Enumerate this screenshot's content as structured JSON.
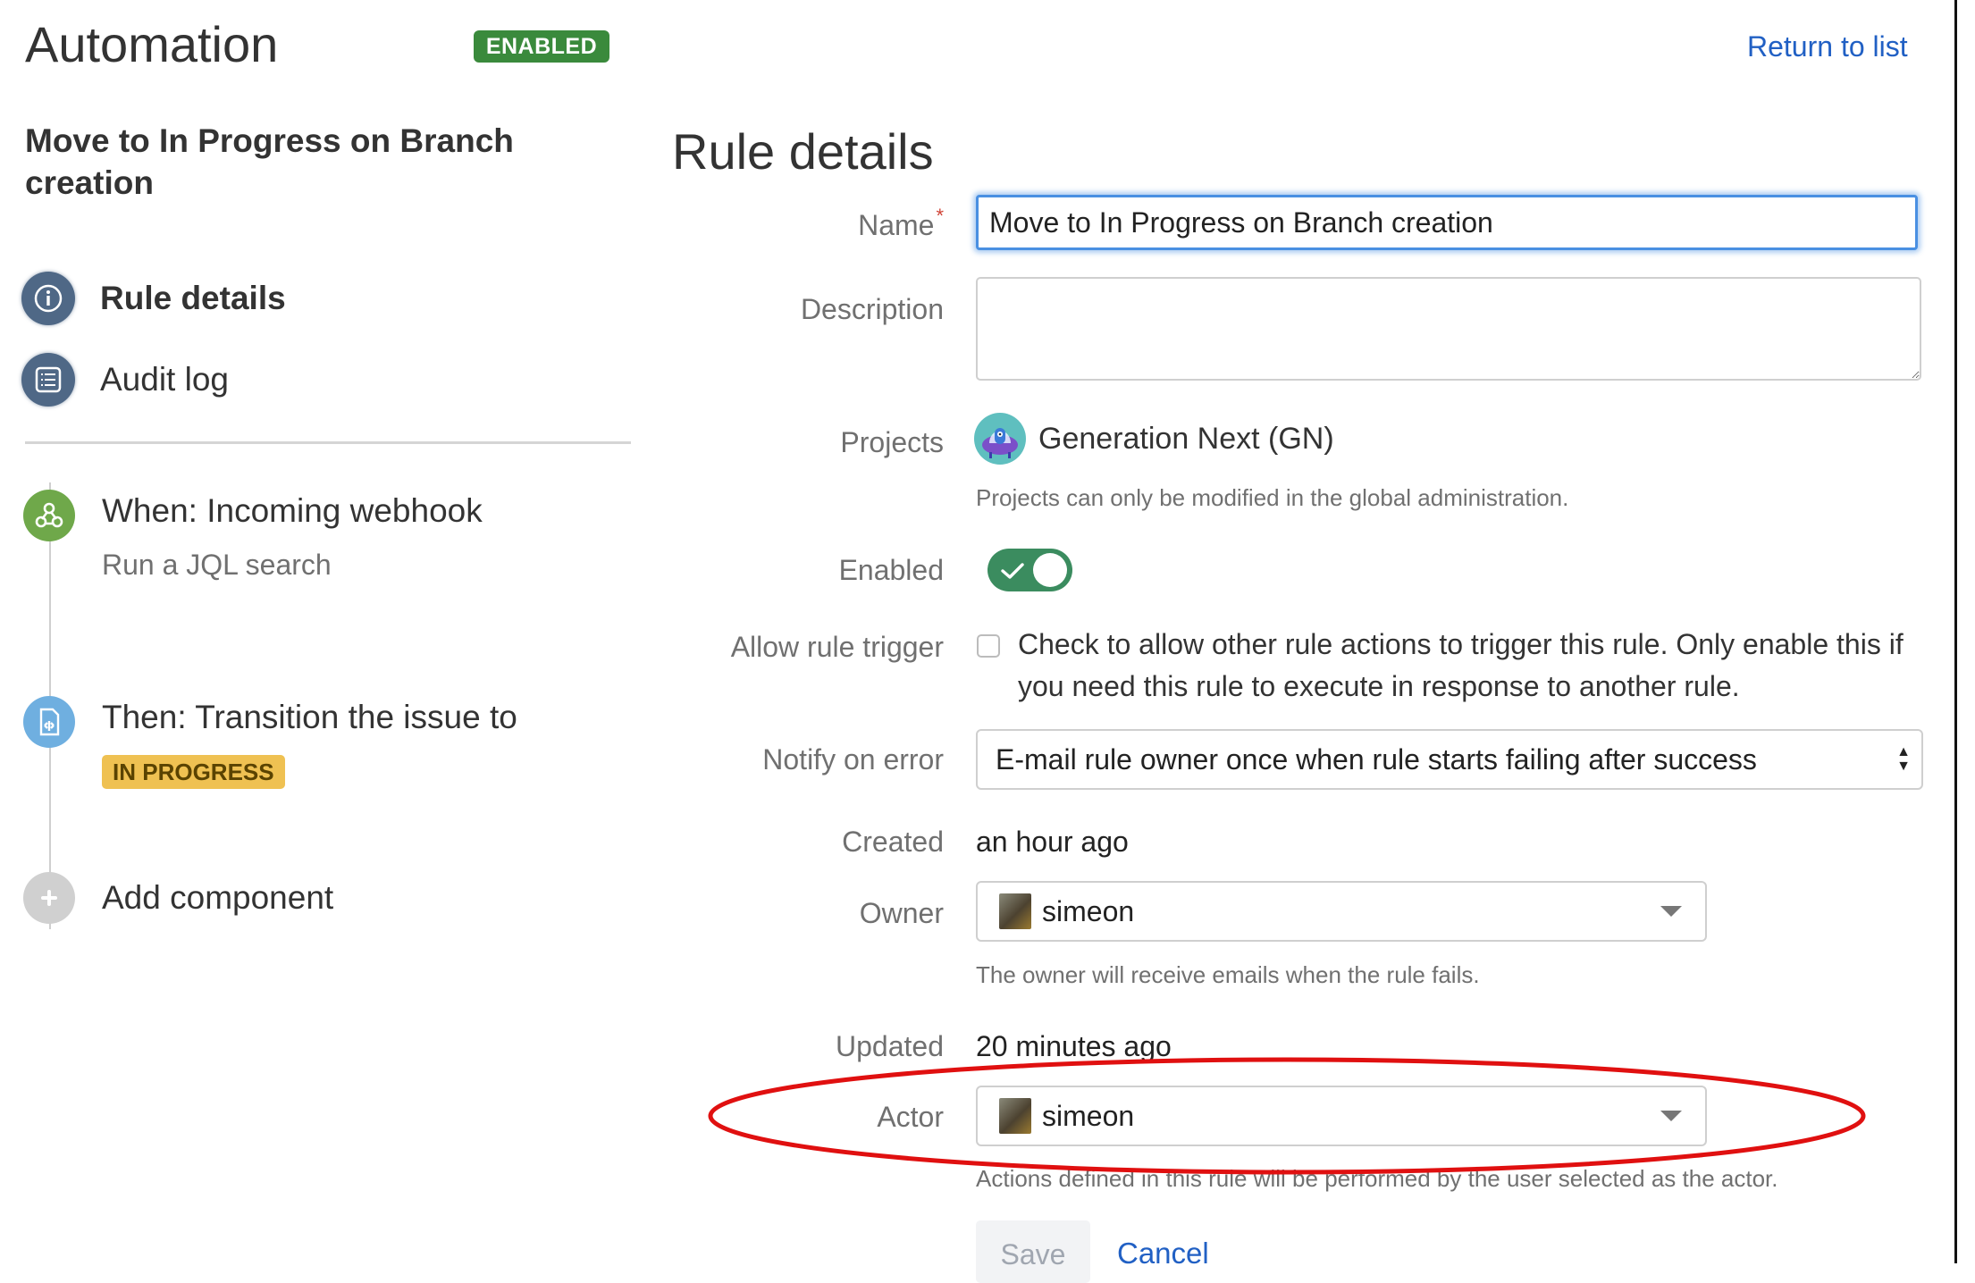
{
  "header": {
    "app_title": "Automation",
    "status_badge": "ENABLED",
    "return_link": "Return to list"
  },
  "sidebar": {
    "rule_name": "Move to In Progress on Branch creation",
    "nav": [
      {
        "label": "Rule details",
        "icon": "info-icon",
        "active": true
      },
      {
        "label": "Audit log",
        "icon": "list-icon",
        "active": false
      }
    ],
    "components": [
      {
        "title": "When: Incoming webhook",
        "subtitle": "Run a JQL search",
        "icon": "webhook-icon",
        "color": "#6fa84a"
      },
      {
        "title": "Then: Transition the issue to",
        "badge": "IN PROGRESS",
        "icon": "transition-icon",
        "color": "#6fafe0"
      }
    ],
    "add_component": {
      "label": "Add component",
      "icon": "plus-icon"
    }
  },
  "form": {
    "title": "Rule details",
    "name": {
      "label": "Name",
      "required": "*",
      "value": "Move to In Progress on Branch creation"
    },
    "description": {
      "label": "Description",
      "value": ""
    },
    "projects": {
      "label": "Projects",
      "value": "Generation Next (GN)",
      "help": "Projects can only be modified in the global administration."
    },
    "enabled": {
      "label": "Enabled",
      "value": true
    },
    "allow_rule_trigger": {
      "label": "Allow rule trigger",
      "checked": false,
      "text": "Check to allow other rule actions to trigger this rule. Only enable this if you need this rule to execute in response to another rule."
    },
    "notify_on_error": {
      "label": "Notify on error",
      "value": "E-mail rule owner once when rule starts failing after success"
    },
    "created": {
      "label": "Created",
      "value": "an hour ago"
    },
    "owner": {
      "label": "Owner",
      "value": "simeon",
      "help": "The owner will receive emails when the rule fails."
    },
    "updated": {
      "label": "Updated",
      "value": "20 minutes ago"
    },
    "actor": {
      "label": "Actor",
      "value": "simeon",
      "help": "Actions defined in this rule will be performed by the user selected as the actor."
    },
    "save_label": "Save",
    "cancel_label": "Cancel"
  },
  "colors": {
    "accent": "#2160c4",
    "enabled_green": "#3a8a3c",
    "toggle_green": "#3b8c5f",
    "in_progress_yellow": "#efc152",
    "annotation_red": "#e01010"
  }
}
